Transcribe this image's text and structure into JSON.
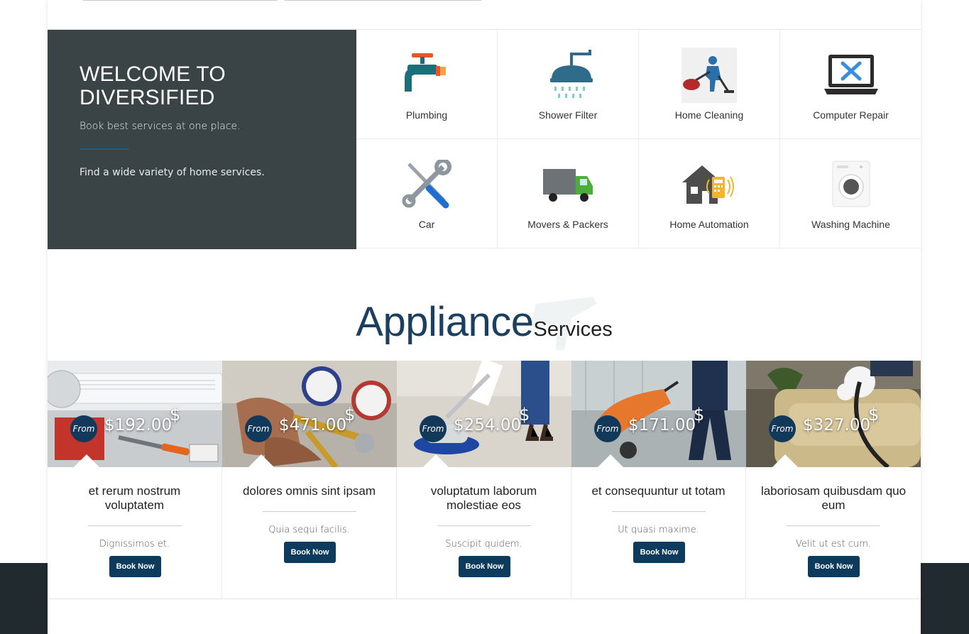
{
  "hero": {
    "title": "WELCOME TO DIVERSIFIED",
    "subtitle": "Book best services at one place.",
    "tagline": "Find a wide variety of home services."
  },
  "services": [
    {
      "label": "Plumbing",
      "icon": "faucet-icon"
    },
    {
      "label": "Shower Filter",
      "icon": "shower-icon"
    },
    {
      "label": "Home Cleaning",
      "icon": "vacuum-cleaning-icon"
    },
    {
      "label": "Computer Repair",
      "icon": "laptop-repair-icon"
    },
    {
      "label": "Car",
      "icon": "wrench-screwdriver-icon"
    },
    {
      "label": "Movers & Packers",
      "icon": "truck-icon"
    },
    {
      "label": "Home Automation",
      "icon": "smart-home-icon"
    },
    {
      "label": "Washing Machine",
      "icon": "washing-machine-icon"
    }
  ],
  "section": {
    "title_main": "Appliance",
    "title_sub": "Services"
  },
  "cards": [
    {
      "from": "From",
      "price": "$192.00",
      "currency": "$",
      "title": "et rerum nostrum voluptatem",
      "desc": "Dignissimos et.",
      "button": "Book Now",
      "photo": "ac-tools-photo"
    },
    {
      "from": "From",
      "price": "$471.00",
      "currency": "$",
      "title": "dolores omnis sint ipsam",
      "desc": "Quia sequi facilis.",
      "button": "Book Now",
      "photo": "gauges-photo"
    },
    {
      "from": "From",
      "price": "$254.00",
      "currency": "$",
      "title": "voluptatum laborum molestiae eos",
      "desc": "Suscipit quidem.",
      "button": "Book Now",
      "photo": "floor-polisher-photo"
    },
    {
      "from": "From",
      "price": "$171.00",
      "currency": "$",
      "title": "et consequuntur ut totam",
      "desc": "Ut quasi maxime.",
      "button": "Book Now",
      "photo": "vacuum-photo"
    },
    {
      "from": "From",
      "price": "$327.00",
      "currency": "$",
      "title": "laboriosam quibusdam quo eum",
      "desc": "Velit ut est cum.",
      "button": "Book Now",
      "photo": "sofa-cleaning-photo"
    }
  ],
  "colors": {
    "hero_bg": "#3a4446",
    "accent": "#0d3b5e",
    "footer_bg": "#212a2e"
  }
}
